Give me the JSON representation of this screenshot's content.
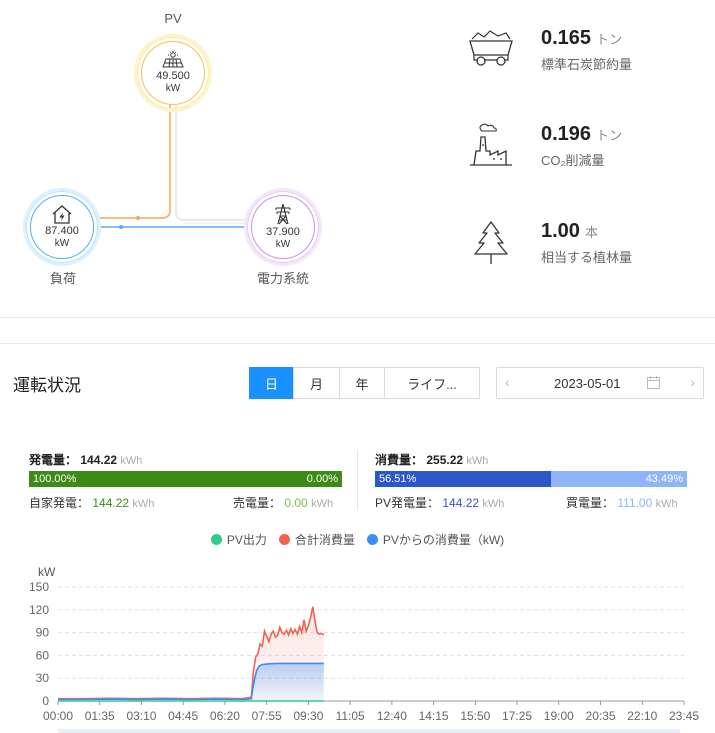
{
  "flow": {
    "pv": {
      "label": "PV",
      "value": "49.500",
      "unit": "kW"
    },
    "load": {
      "label": "負荷",
      "value": "87.400",
      "unit": "kW"
    },
    "grid": {
      "label": "電力系統",
      "value": "37.900",
      "unit": "kW"
    },
    "colors": {
      "pv": "#f5c34a",
      "load": "#4ab3f5",
      "grid": "#c990e8",
      "pv_line": "#f2a65a",
      "load_line": "#5aa8f2"
    }
  },
  "stats": [
    {
      "icon": "coal-cart-icon",
      "value": "0.165",
      "unit": "トン",
      "label": "標準石炭節約量"
    },
    {
      "icon": "factory-icon",
      "value": "0.196",
      "unit": "トン",
      "label": "CO₂削減量"
    },
    {
      "icon": "tree-icon",
      "value": "1.00",
      "unit": "本",
      "label": "相当する植林量"
    }
  ],
  "operation": {
    "title": "運転状況",
    "tabs": [
      "日",
      "月",
      "年",
      "ライフ..."
    ],
    "active_tab": "日",
    "date": "2023-05-01"
  },
  "summary": {
    "generation": {
      "label": "発電量：",
      "value": "144.22",
      "unit": "kWh",
      "self_pct": "100.00%",
      "sell_pct": "0.00%",
      "self_label": "自家発電：",
      "self_value": "144.22",
      "self_unit": "kWh",
      "sell_label": "売電量：",
      "sell_value": "0.00",
      "sell_unit": "kWh",
      "self_fraction": 1.0
    },
    "consumption": {
      "label": "消費量：",
      "value": "255.22",
      "unit": "kWh",
      "pv_pct": "56.51%",
      "buy_pct": "43.49%",
      "pv_label": "PV発電量：",
      "pv_value": "144.22",
      "pv_unit": "kWh",
      "buy_label": "買電量：",
      "buy_value": "111.00",
      "buy_unit": "kWh",
      "pv_fraction": 0.5651
    },
    "colors": {
      "gen_bar": "#3d8a17",
      "sell_value": "#7ac142",
      "self_value": "#3d8a17",
      "pv_bar": "#2b57c9",
      "buy_bar": "#8fb4f8",
      "pv_value": "#2b57c9",
      "buy_value": "#8fb4f8"
    }
  },
  "legend": [
    {
      "name": "PV出力",
      "color": "#2ecc8f"
    },
    {
      "name": "合計消費量",
      "color": "#ee6352"
    },
    {
      "name": "PVからの消費量（kW)",
      "color": "#3a8ef5"
    }
  ],
  "chart_data": {
    "type": "line",
    "ylabel": "kW",
    "ylim": [
      0,
      150
    ],
    "yticks": [
      0,
      30,
      60,
      90,
      120,
      150
    ],
    "xticks": [
      "00:00",
      "01:35",
      "03:10",
      "04:45",
      "06:20",
      "07:55",
      "09:30",
      "11:05",
      "12:40",
      "14:15",
      "15:50",
      "17:25",
      "19:00",
      "20:35",
      "22:10",
      "23:45"
    ],
    "x_range_minutes": [
      0,
      1425
    ],
    "grid": true,
    "series": [
      {
        "name": "合計消費量",
        "color": "#ee6352",
        "points": [
          [
            0,
            3
          ],
          [
            60,
            3
          ],
          [
            120,
            3.5
          ],
          [
            180,
            3
          ],
          [
            240,
            3.5
          ],
          [
            300,
            3
          ],
          [
            360,
            3.5
          ],
          [
            420,
            3
          ],
          [
            440,
            5
          ],
          [
            445,
            40
          ],
          [
            450,
            58
          ],
          [
            455,
            62
          ],
          [
            460,
            75
          ],
          [
            465,
            72
          ],
          [
            470,
            92
          ],
          [
            475,
            85
          ],
          [
            480,
            78
          ],
          [
            485,
            88
          ],
          [
            490,
            92
          ],
          [
            495,
            84
          ],
          [
            500,
            86
          ],
          [
            505,
            97
          ],
          [
            510,
            90
          ],
          [
            515,
            88
          ],
          [
            520,
            93
          ],
          [
            525,
            87
          ],
          [
            530,
            95
          ],
          [
            535,
            89
          ],
          [
            540,
            94
          ],
          [
            545,
            88
          ],
          [
            550,
            98
          ],
          [
            555,
            90
          ],
          [
            560,
            107
          ],
          [
            565,
            92
          ],
          [
            570,
            99
          ],
          [
            575,
            110
          ],
          [
            580,
            124
          ],
          [
            585,
            105
          ],
          [
            590,
            90
          ],
          [
            595,
            88
          ],
          [
            600,
            89
          ],
          [
            605,
            87
          ]
        ]
      },
      {
        "name": "PVからの消費量（kW)",
        "color": "#3a8ef5",
        "points": [
          [
            0,
            2
          ],
          [
            60,
            2
          ],
          [
            120,
            2.5
          ],
          [
            180,
            2
          ],
          [
            240,
            2.5
          ],
          [
            300,
            2
          ],
          [
            360,
            2.5
          ],
          [
            420,
            2
          ],
          [
            440,
            3
          ],
          [
            443,
            15
          ],
          [
            448,
            30
          ],
          [
            452,
            40
          ],
          [
            458,
            46
          ],
          [
            465,
            48
          ],
          [
            480,
            49
          ],
          [
            500,
            49.5
          ],
          [
            540,
            49.5
          ],
          [
            580,
            49.5
          ],
          [
            605,
            49.5
          ]
        ]
      },
      {
        "name": "PV出力",
        "color": "#2ecc8f",
        "points": [
          [
            0,
            0
          ],
          [
            605,
            0
          ]
        ]
      }
    ]
  }
}
